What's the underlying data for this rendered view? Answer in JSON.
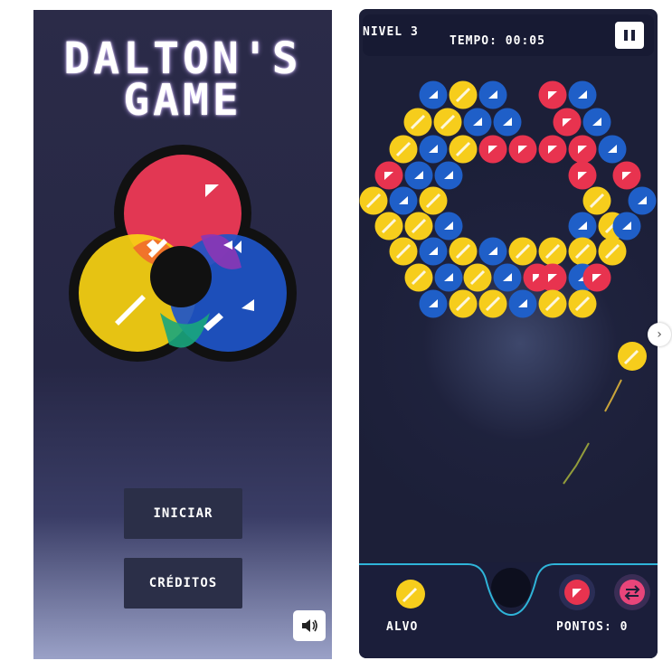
{
  "menu": {
    "title_line1": "DALTON'S",
    "title_line2": "GAME",
    "start_label": "INICIAR",
    "credits_label": "CRÉDITOS",
    "sound_icon": "speaker-icon"
  },
  "game": {
    "level_label": "NIVEL 3",
    "timer_label": "TEMPO: 00:05",
    "pause_icon": "pause-icon",
    "target_label": "ALVO",
    "score_label": "PONTOS: 0",
    "target_color": "yellow",
    "queue": [
      "red",
      "swap"
    ]
  },
  "colors": {
    "red": "#e8334f",
    "yellow": "#f6cd1c",
    "blue": "#1f5fc8",
    "cyan_border": "#2fb4d8",
    "swap_pink": "#e8457a"
  },
  "bubbles": [
    "blue",
    "yellow",
    "blue",
    "red",
    "blue",
    "yellow",
    "yellow",
    "blue",
    "blue",
    "red",
    "blue",
    "yellow",
    "blue",
    "yellow",
    "red",
    "red",
    "red",
    "red",
    "blue",
    "red",
    "blue",
    "blue",
    "red",
    "red",
    "yellow",
    "blue",
    "yellow",
    "yellow",
    "blue",
    "yellow",
    "yellow",
    "blue",
    "blue",
    "yellow",
    "blue",
    "yellow",
    "blue",
    "yellow",
    "blue",
    "yellow",
    "yellow",
    "yellow",
    "yellow",
    "yellow",
    "blue",
    "yellow",
    "blue",
    "red",
    "red",
    "blue",
    "red",
    "blue",
    "yellow",
    "yellow",
    "blue",
    "yellow",
    "yellow"
  ]
}
